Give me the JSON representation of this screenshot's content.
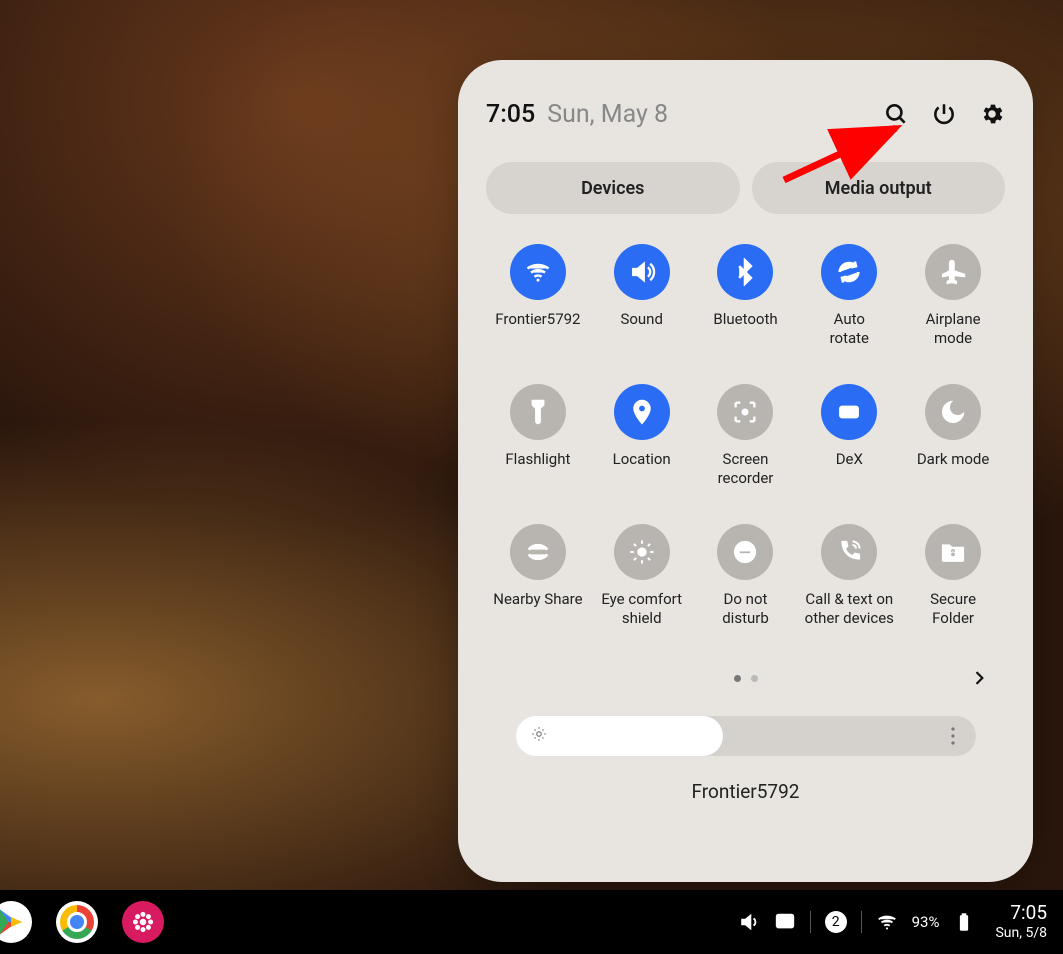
{
  "panel": {
    "time": "7:05",
    "date": "Sun, May 8",
    "header_icons": [
      "search",
      "power",
      "settings"
    ],
    "pills": {
      "devices": "Devices",
      "media_output": "Media output"
    },
    "tiles": [
      {
        "id": "wifi",
        "label": "Frontier5792",
        "on": true
      },
      {
        "id": "sound",
        "label": "Sound",
        "on": true
      },
      {
        "id": "bluetooth",
        "label": "Bluetooth",
        "on": true
      },
      {
        "id": "auto-rotate",
        "label": "Auto\nrotate",
        "on": true
      },
      {
        "id": "airplane",
        "label": "Airplane\nmode",
        "on": false
      },
      {
        "id": "flashlight",
        "label": "Flashlight",
        "on": false
      },
      {
        "id": "location",
        "label": "Location",
        "on": true
      },
      {
        "id": "screen-recorder",
        "label": "Screen\nrecorder",
        "on": false
      },
      {
        "id": "dex",
        "label": "DeX",
        "on": true
      },
      {
        "id": "dark-mode",
        "label": "Dark mode",
        "on": false
      },
      {
        "id": "nearby-share",
        "label": "Nearby Share",
        "on": false
      },
      {
        "id": "eye-comfort",
        "label": "Eye comfort\nshield",
        "on": false
      },
      {
        "id": "dnd",
        "label": "Do not\ndisturb",
        "on": false
      },
      {
        "id": "call-text",
        "label": "Call & text on\nother devices",
        "on": false
      },
      {
        "id": "secure-folder",
        "label": "Secure\nFolder",
        "on": false
      }
    ],
    "pagination": {
      "pages": 2,
      "active": 0
    },
    "brightness": {
      "percent": 45
    },
    "footer": "Frontier5792",
    "annotation_arrow_target": "power-icon"
  },
  "colors": {
    "accent": "#2a6df4",
    "off": "#b8b5b1",
    "panel_bg": "#e8e5e1"
  },
  "taskbar": {
    "apps": [
      "play-store",
      "chrome",
      "gallery"
    ],
    "status": {
      "notifications": "2",
      "battery_percent": "93%",
      "wifi_on": true,
      "volume_on": true,
      "cast_on": true
    },
    "clock": {
      "time": "7:05",
      "date": "Sun, 5/8"
    }
  }
}
